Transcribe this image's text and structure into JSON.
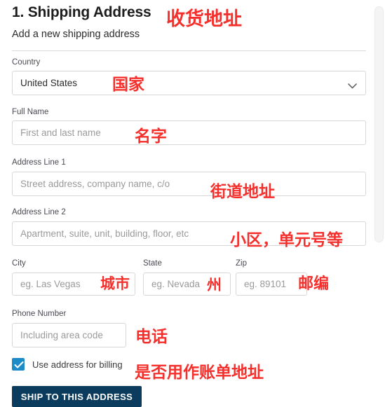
{
  "header": {
    "title": "1. Shipping Address",
    "subtitle": "Add a new shipping address"
  },
  "form": {
    "country": {
      "label": "Country",
      "value": "United States",
      "chevron_icon": "chevron-down-icon"
    },
    "full_name": {
      "label": "Full Name",
      "placeholder": "First and last name"
    },
    "address_line_1": {
      "label": "Address Line 1",
      "placeholder": "Street address, company name, c/o"
    },
    "address_line_2": {
      "label": "Address Line 2",
      "placeholder": "Apartment, suite, unit, building, floor, etc"
    },
    "city": {
      "label": "City",
      "placeholder": "eg. Las Vegas"
    },
    "state": {
      "label": "State",
      "placeholder": "eg. Nevada"
    },
    "zip": {
      "label": "Zip",
      "placeholder": "eg. 89101"
    },
    "phone": {
      "label": "Phone Number",
      "placeholder": "Including area code"
    },
    "billing_checkbox": {
      "label": "Use address for billing",
      "checked": true,
      "icon": "check-icon"
    },
    "submit": {
      "label": "SHIP TO THIS ADDRESS"
    }
  },
  "annotations": [
    {
      "text": "收货地址",
      "for": "page-title"
    },
    {
      "text": "国家",
      "for": "country"
    },
    {
      "text": "名字",
      "for": "full-name"
    },
    {
      "text": "街道地址",
      "for": "address-line-1"
    },
    {
      "text": "小区，单元号等",
      "for": "address-line-2"
    },
    {
      "text": "城市",
      "for": "city"
    },
    {
      "text": "州",
      "for": "state"
    },
    {
      "text": "邮编",
      "for": "zip"
    },
    {
      "text": "电话",
      "for": "phone"
    },
    {
      "text": "是否用作账单地址",
      "for": "billing-checkbox"
    }
  ],
  "colors": {
    "annotation_red": "#f5302c",
    "button_navy": "#0b3c5d",
    "checkbox_blue": "#1e8bc9",
    "input_border": "#d8d8d8",
    "divider": "#d9d9d9"
  }
}
